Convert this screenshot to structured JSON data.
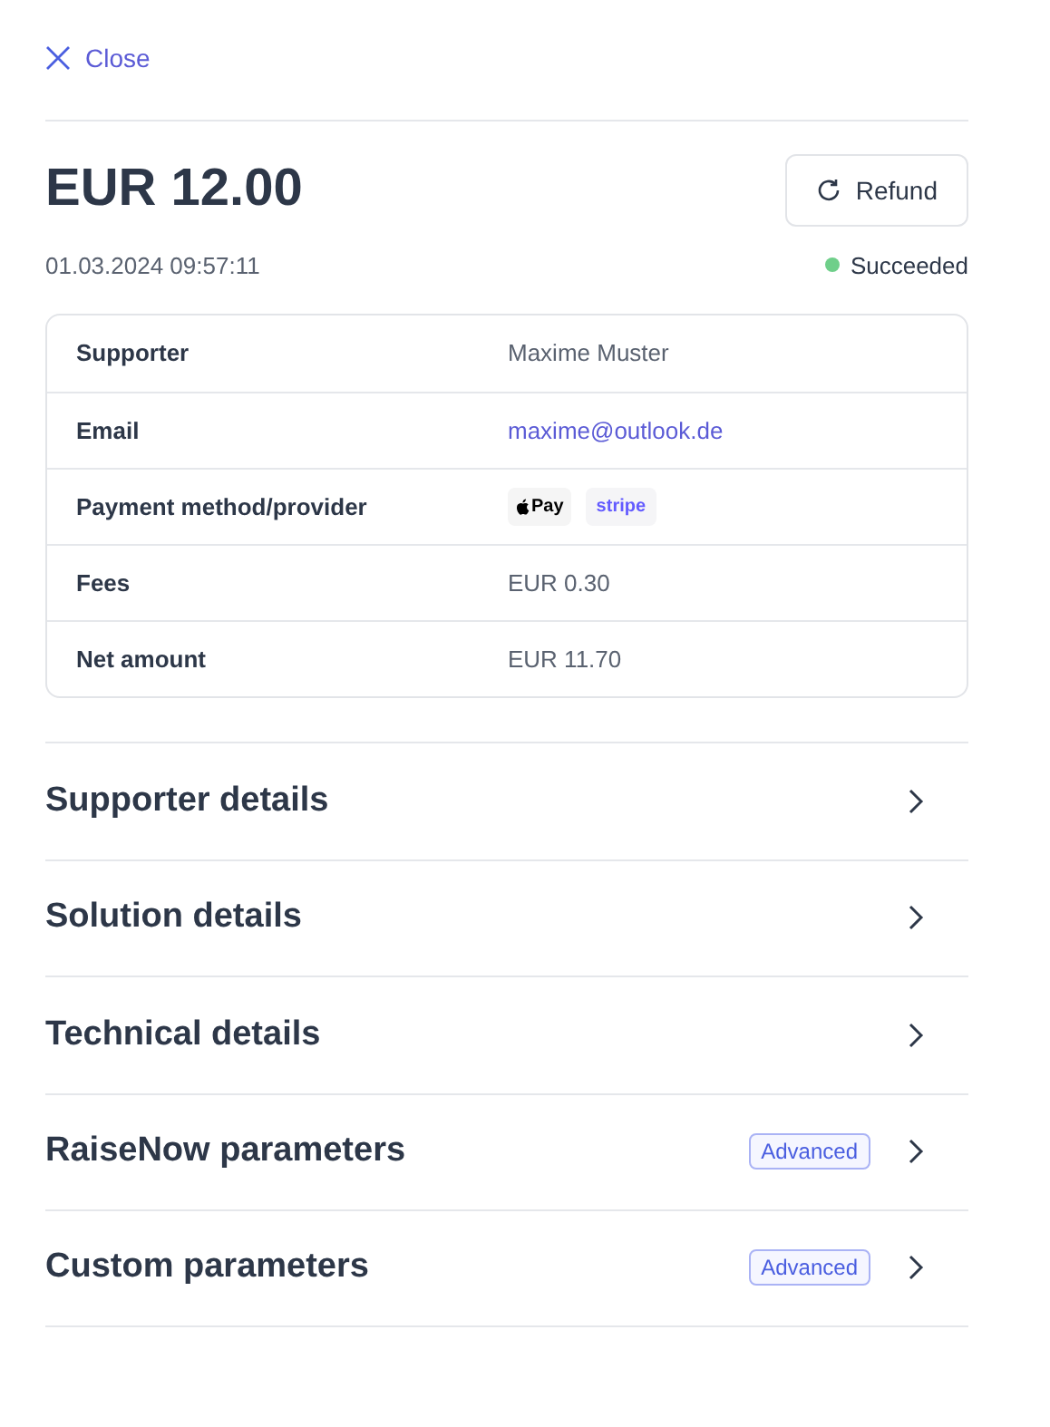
{
  "close": "Close",
  "amount": "EUR 12.00",
  "refund": "Refund",
  "date": "01.03.2024 09:57:11",
  "status": {
    "label": "Succeeded",
    "color": "#6fcf8a"
  },
  "details": [
    {
      "kind": "text",
      "label": "Supporter",
      "value": "Maxime Muster"
    },
    {
      "kind": "link",
      "label": "Email",
      "value": "maxime@outlook.de"
    },
    {
      "kind": "badges",
      "label": "Payment method/provider",
      "badges": [
        {
          "kind": "applepay",
          "text": "Pay"
        },
        {
          "kind": "stripe",
          "text": "stripe"
        }
      ]
    },
    {
      "kind": "text",
      "label": "Fees",
      "value": "EUR 0.30"
    },
    {
      "kind": "text",
      "label": "Net amount",
      "value": "EUR 11.70"
    }
  ],
  "sections": [
    {
      "title": "Supporter details"
    },
    {
      "title": "Solution details"
    },
    {
      "title": "Technical details"
    },
    {
      "title": "RaiseNow parameters",
      "badge": "Advanced"
    },
    {
      "title": "Custom parameters",
      "badge": "Advanced"
    }
  ]
}
